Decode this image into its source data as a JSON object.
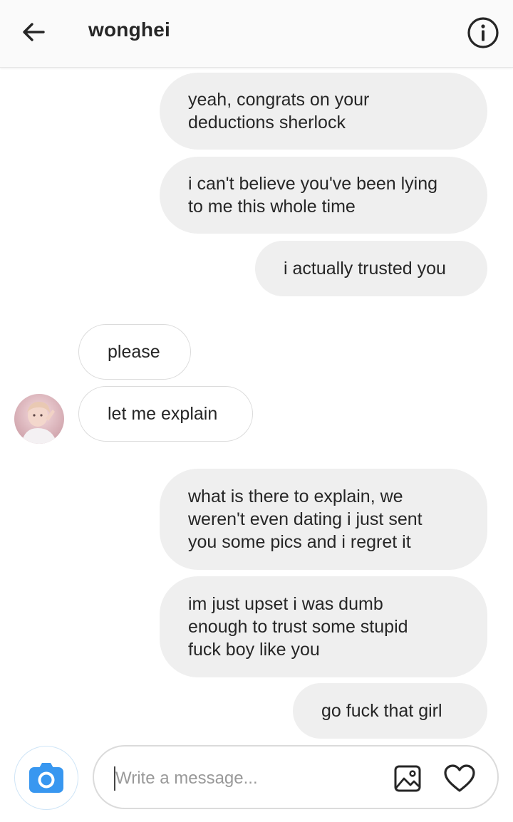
{
  "header": {
    "title": "wonghei",
    "back_icon": "arrow-left-icon",
    "info_icon": "info-circle-icon"
  },
  "messages": [
    {
      "side": "outgoing",
      "text": "yeah, congrats on your\ndeductions sherlock"
    },
    {
      "side": "outgoing",
      "text": "i can't believe you've been lying\nto me this whole time"
    },
    {
      "side": "outgoing",
      "text": "i actually trusted you"
    },
    {
      "side": "incoming",
      "text": "please"
    },
    {
      "side": "incoming",
      "text": "let me explain"
    },
    {
      "side": "outgoing",
      "text": "what is there to explain, we\nweren't even dating i just sent\nyou some pics and i regret it"
    },
    {
      "side": "outgoing",
      "text": "im just upset i was dumb\nenough to trust some stupid\nfuck boy like you"
    },
    {
      "side": "outgoing",
      "text": "go fuck that girl"
    }
  ],
  "composer": {
    "placeholder": "Write a message...",
    "value": "",
    "camera_icon": "camera-icon",
    "gallery_icon": "image-gallery-icon",
    "heart_icon": "heart-icon"
  },
  "colors": {
    "accent": "#3897f0",
    "outgoing_bubble": "#efefef",
    "incoming_border": "#dbdbdb"
  }
}
